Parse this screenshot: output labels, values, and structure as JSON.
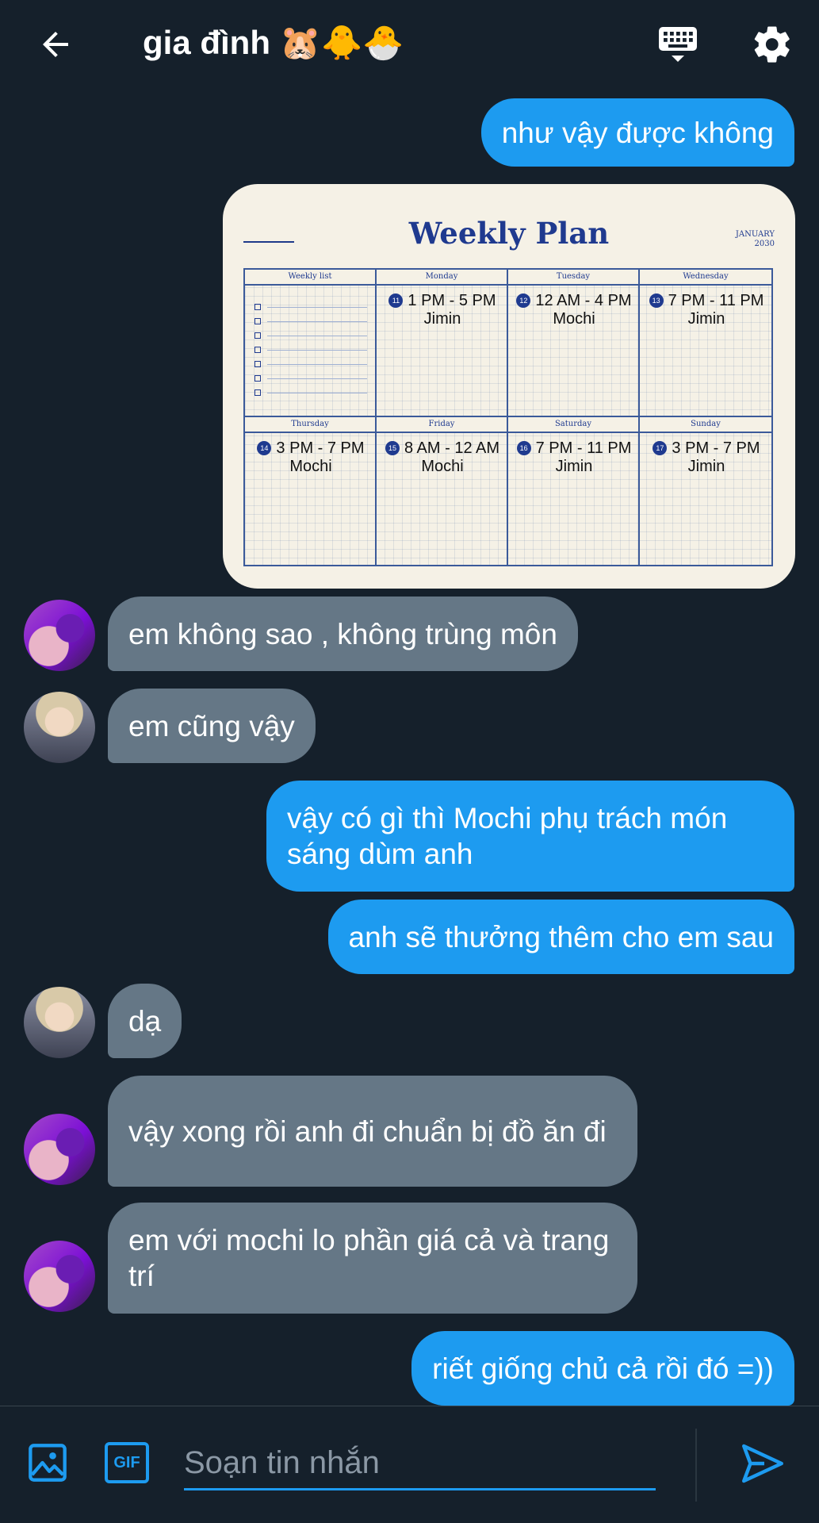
{
  "header": {
    "title": "gia đình 🐹🐥🐣",
    "icons": [
      "back-arrow-icon",
      "keyboard-icon",
      "gear-icon"
    ]
  },
  "messages": [
    {
      "dir": "out",
      "text": "như vậy được không"
    },
    {
      "dir": "out",
      "type": "image",
      "name": "weekly-plan"
    },
    {
      "dir": "in",
      "text": "em không sao , không trùng môn"
    },
    {
      "dir": "in",
      "text": "em cũng vậy"
    },
    {
      "dir": "out",
      "text": "vậy có gì thì Mochi phụ trách món sáng dùm anh"
    },
    {
      "dir": "out",
      "text": "anh sẽ thưởng thêm cho em sau"
    },
    {
      "dir": "in",
      "text": "dạ"
    },
    {
      "dir": "in",
      "text": "vậy xong rồi anh đi chuẩn bị đồ ăn đi"
    },
    {
      "dir": "in",
      "text": "em với mochi lo phần giá cả và trang trí"
    },
    {
      "dir": "out",
      "text": "riết giống chủ cả rồi đó =))"
    }
  ],
  "plan": {
    "title": "Weekly Plan",
    "month": "JANUARY",
    "year": "2030",
    "list_header": "Weekly list",
    "days": [
      {
        "name": "Monday",
        "badge": "11",
        "time": "1 PM - 5 PM",
        "who": "Jimin"
      },
      {
        "name": "Tuesday",
        "badge": "12",
        "time": "12 AM - 4 PM",
        "who": "Mochi"
      },
      {
        "name": "Wednesday",
        "badge": "13",
        "time": "7 PM - 11 PM",
        "who": "Jimin"
      },
      {
        "name": "Thursday",
        "badge": "14",
        "time": "3 PM - 7 PM",
        "who": "Mochi"
      },
      {
        "name": "Friday",
        "badge": "15",
        "time": "8 AM - 12 AM",
        "who": "Mochi"
      },
      {
        "name": "Saturday",
        "badge": "16",
        "time": "7 PM - 11 PM",
        "who": "Jimin"
      },
      {
        "name": "Sunday",
        "badge": "17",
        "time": "3 PM - 7 PM",
        "who": "Jimin"
      }
    ]
  },
  "compose": {
    "placeholder": "Soạn tin nhắn",
    "gif_label": "GIF",
    "icons": [
      "image-icon",
      "gif-icon",
      "send-icon"
    ]
  },
  "colors": {
    "background": "#15202b",
    "outgoing": "#1d9bf0",
    "incoming": "#657786",
    "accent": "#1d9bf0"
  }
}
